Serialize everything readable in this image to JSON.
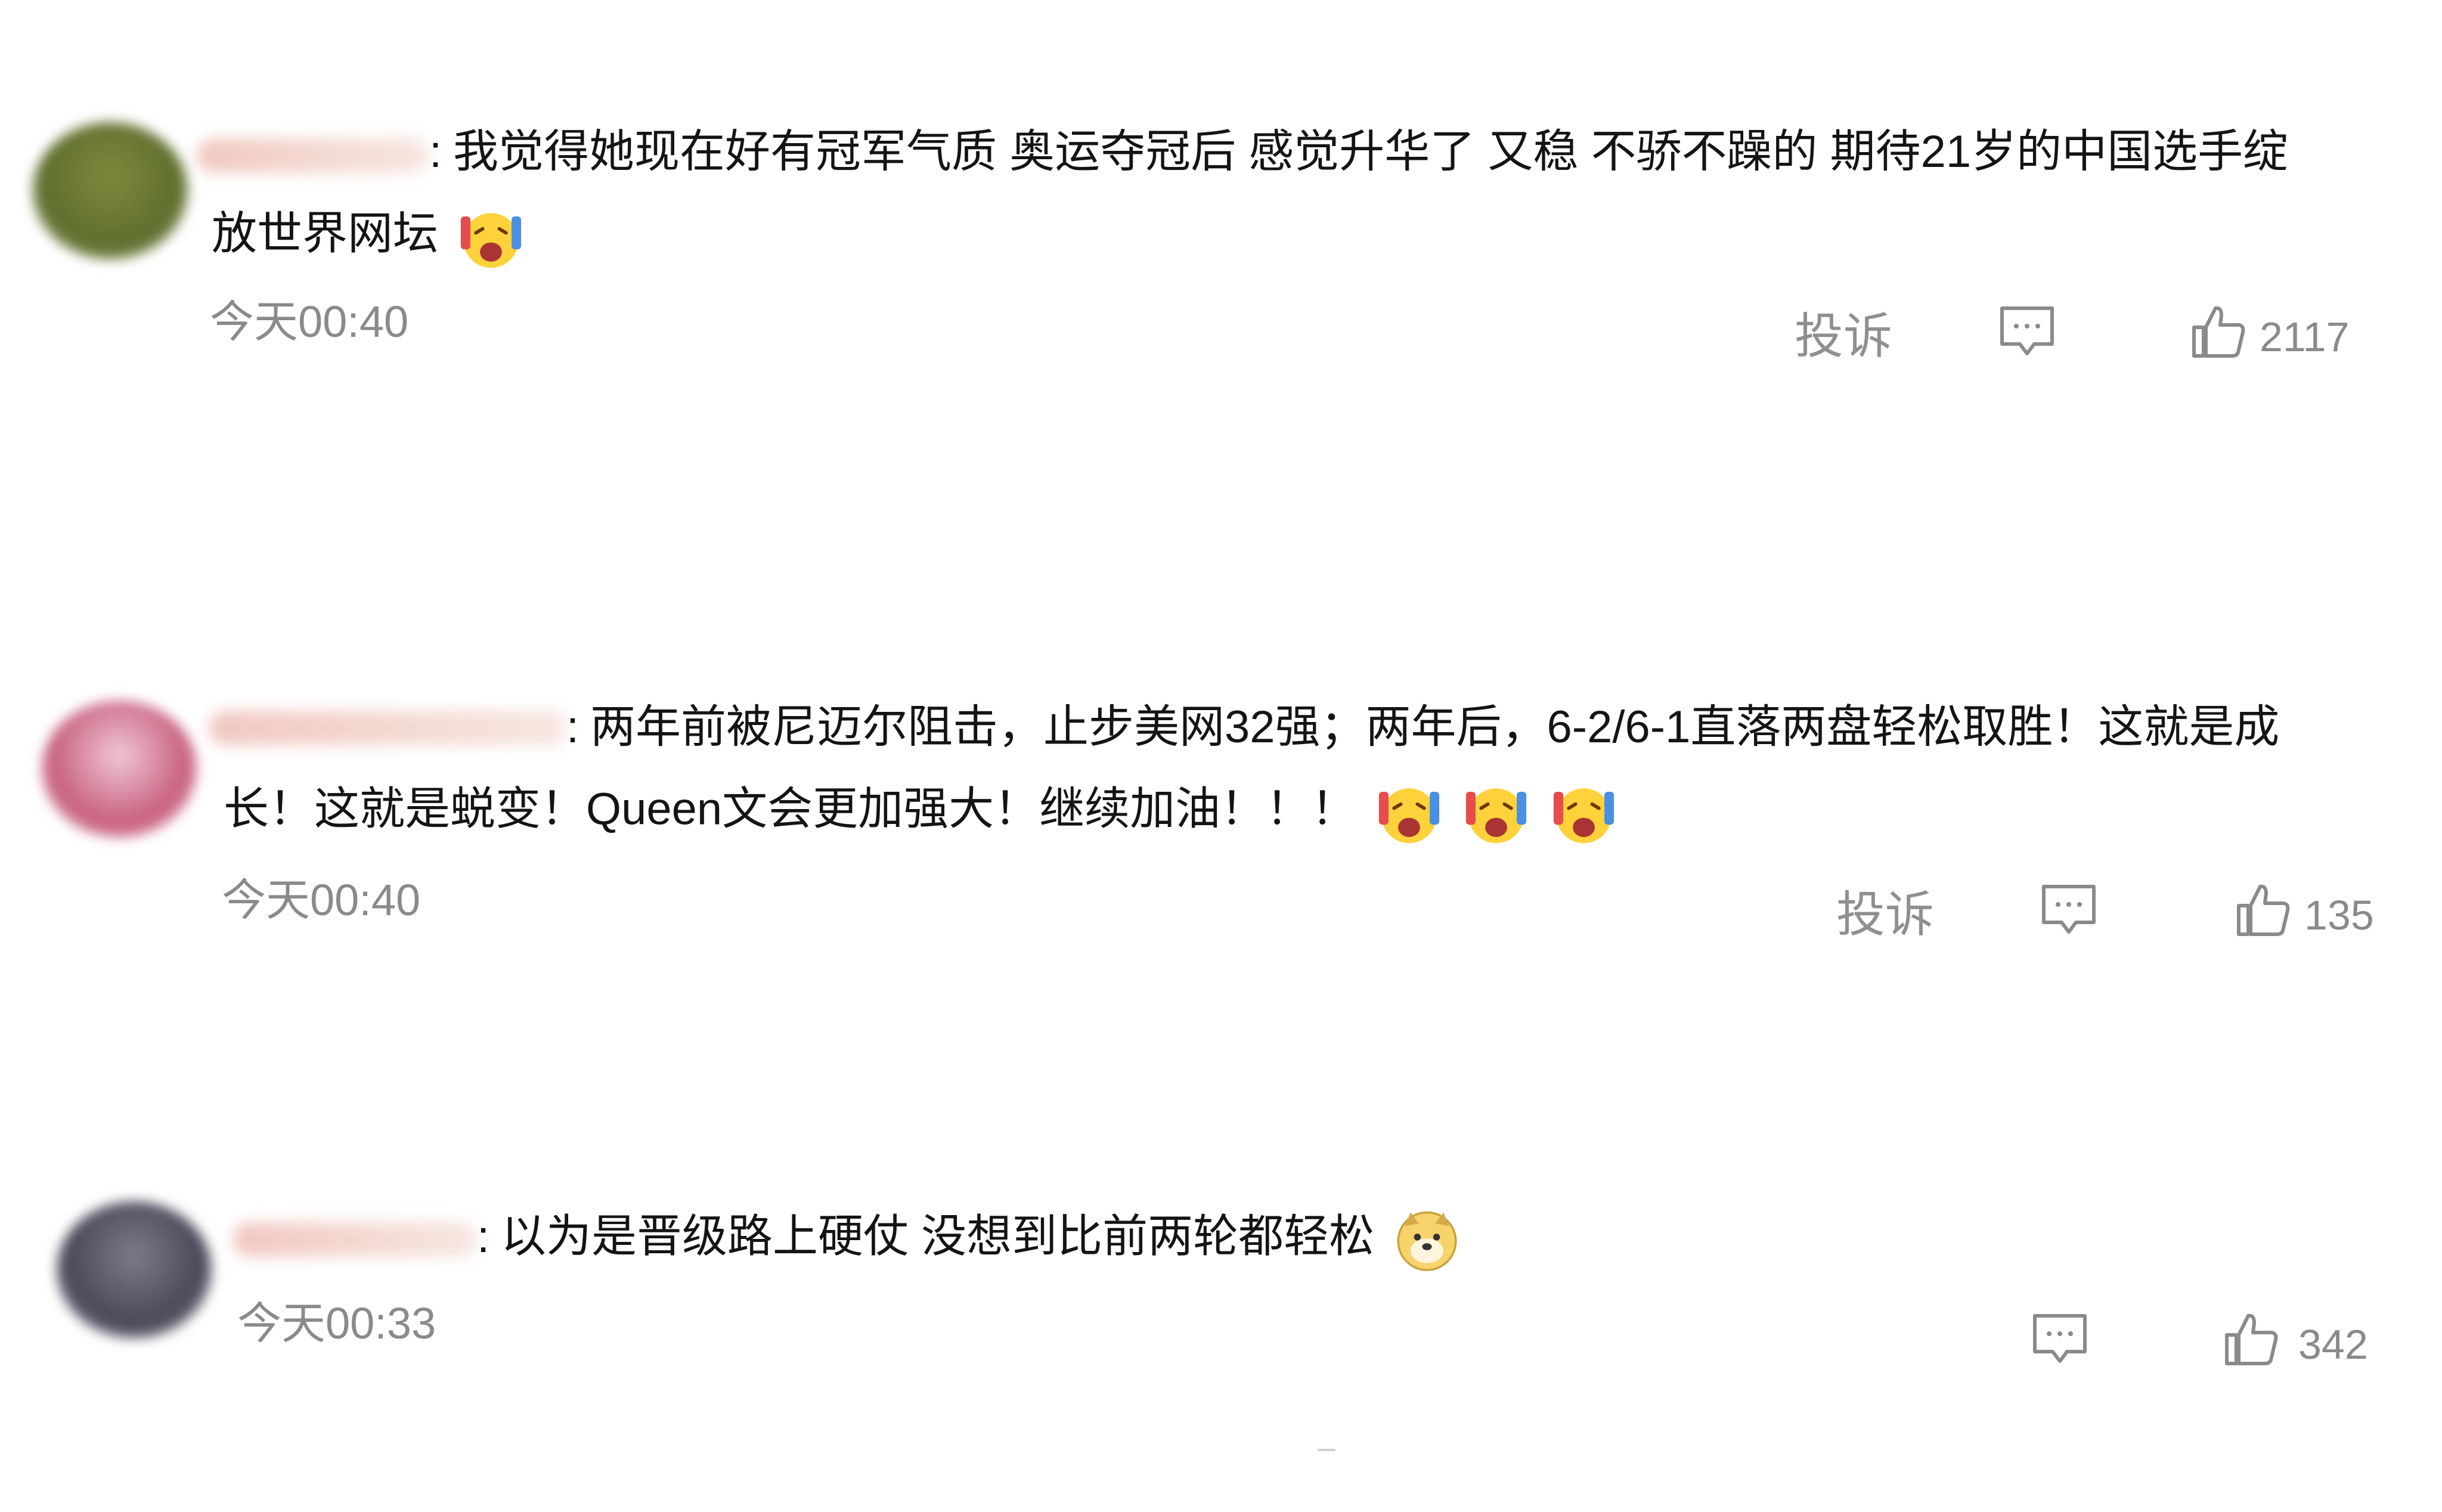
{
  "comments": [
    {
      "line1": "我觉得她现在好有冠军气质 奥运夺冠后 感觉升华了 又稳 不骄不躁的 期待21岁的中国选手绽",
      "line2": "放世界网坛",
      "time": "今天00:40",
      "report": "投诉",
      "likes": "2117",
      "emoji": "scream-cheer-icon"
    },
    {
      "line1": "两年前被尼迈尔阻击，止步美网32强；两年后，6-2/6-1直落两盘轻松取胜！这就是成",
      "line2": "长！这就是蜕变！Queen文会更加强大！继续加油！！！",
      "time": "今天00:40",
      "report": "投诉",
      "likes": "135",
      "emoji": "scream-cheer-icon"
    },
    {
      "line1": "以为是晋级路上硬仗 没想到比前两轮都轻松",
      "time": "今天00:33",
      "likes": "342",
      "emoji": "doge-icon"
    }
  ],
  "colors": {
    "text": "#141414",
    "meta": "#8a8a8a"
  }
}
